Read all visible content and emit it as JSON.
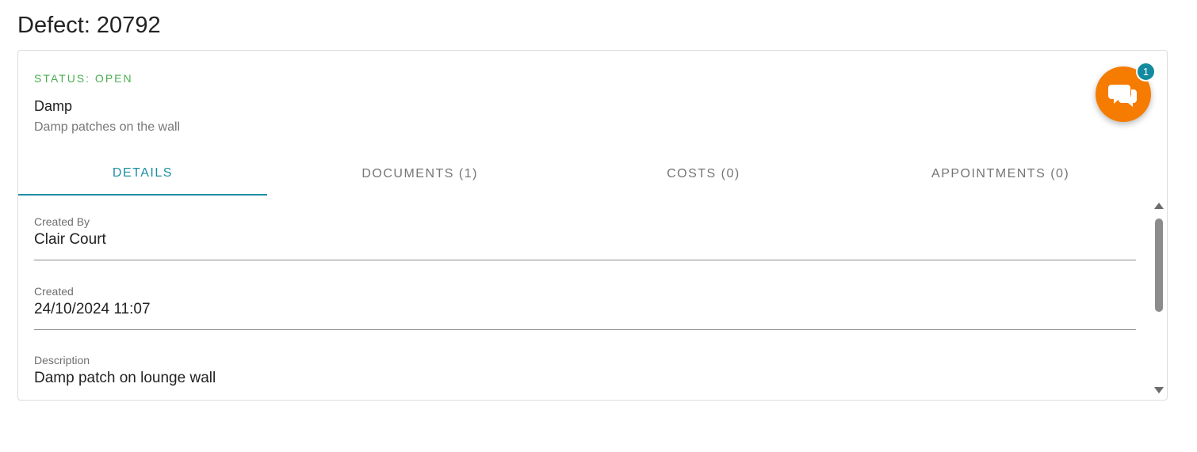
{
  "page": {
    "title": "Defect: 20792"
  },
  "defect": {
    "status": "STATUS: OPEN",
    "type": "Damp",
    "summary": "Damp patches on the wall"
  },
  "tabs": [
    {
      "label": "DETAILS",
      "active": true
    },
    {
      "label": "DOCUMENTS (1)",
      "active": false
    },
    {
      "label": "COSTS (0)",
      "active": false
    },
    {
      "label": "APPOINTMENTS (0)",
      "active": false
    }
  ],
  "details": {
    "created_by": {
      "label": "Created By",
      "value": "Clair Court"
    },
    "created": {
      "label": "Created",
      "value": "24/10/2024 11:07"
    },
    "description": {
      "label": "Description",
      "value": "Damp patch on lounge wall"
    }
  },
  "chat": {
    "icon": "chat-bubbles-icon",
    "badge_count": "1"
  },
  "colors": {
    "status_open": "#4caf50",
    "tab_active": "#1e8fa3",
    "chat_fab": "#f57c00",
    "badge": "#138a9e"
  }
}
